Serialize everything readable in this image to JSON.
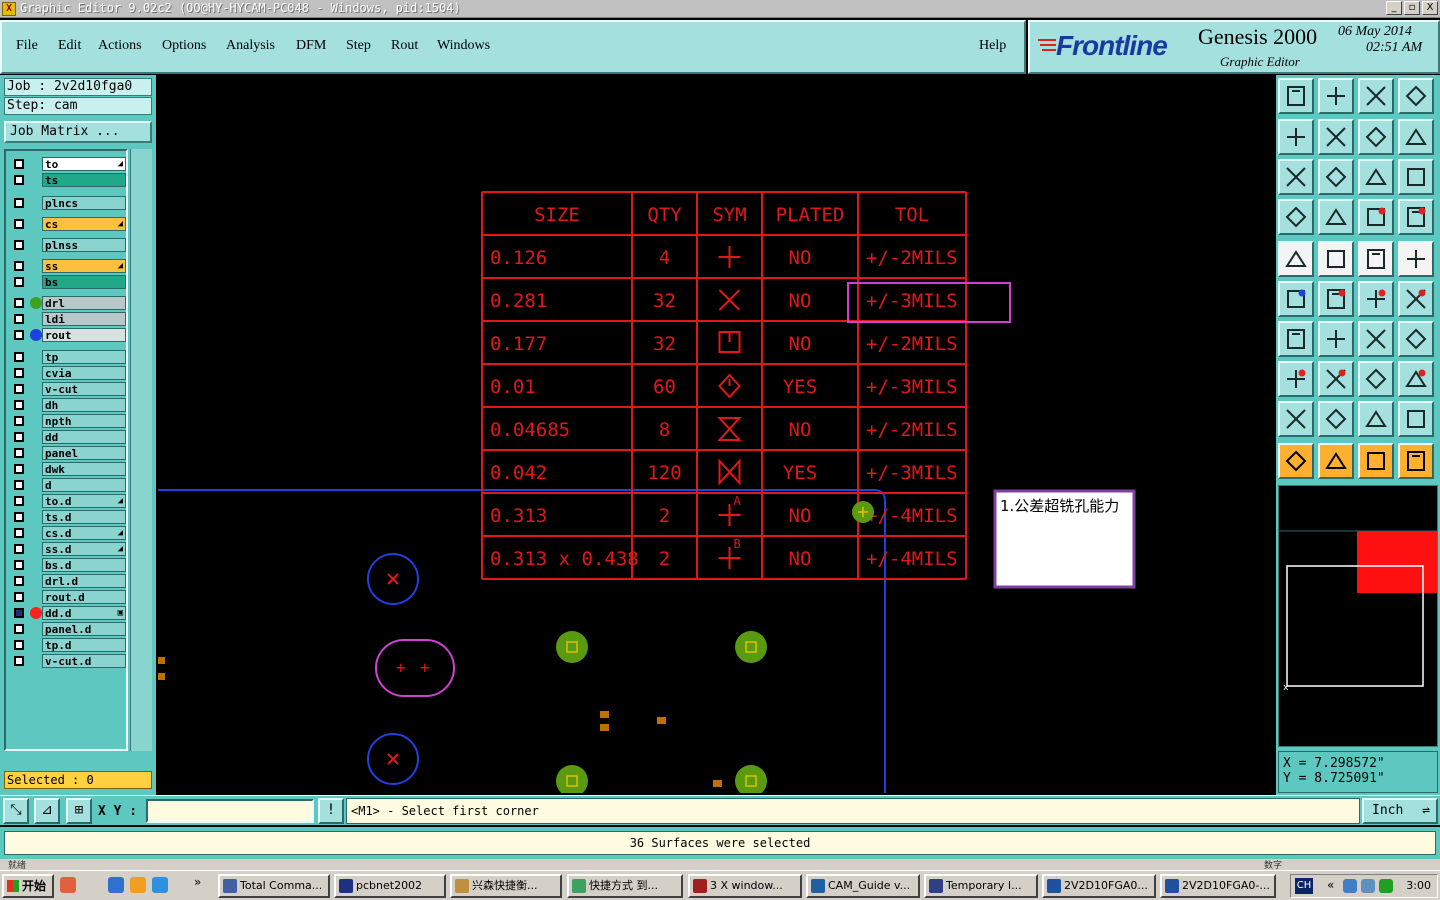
{
  "window": {
    "title": "Graphic Editor 9.02c2 (OO@HY-HYCAM-PC048 - Windows, pid:1504)",
    "minimize": "_",
    "restore": "▫",
    "close": "X"
  },
  "menu": {
    "items": [
      "File",
      "Edit",
      "Actions",
      "Options",
      "Analysis",
      "DFM",
      "Step",
      "Rout",
      "Windows"
    ],
    "help": "Help"
  },
  "brand": {
    "logo": "Frontline",
    "product": "Genesis 2000",
    "subtitle": "Graphic Editor",
    "date": "06 May 2014",
    "time": "02:51 AM"
  },
  "job": {
    "job_label": "Job : 2v2d10fga0",
    "step_label": "Step: cam",
    "matrix_button": "Job Matrix ..."
  },
  "layers": [
    {
      "name": "to",
      "color": "#ffffff",
      "mark": "◢",
      "dot": ""
    },
    {
      "name": "ts",
      "color": "#20a888",
      "mark": "",
      "dot": ""
    },
    {
      "name": "plncs",
      "color": "#8ad4d0",
      "mark": "",
      "dot": ""
    },
    {
      "name": "cs",
      "color": "#ffc040",
      "mark": "◢",
      "dot": ""
    },
    {
      "name": "plnss",
      "color": "#8ad4d0",
      "mark": "",
      "dot": ""
    },
    {
      "name": "ss",
      "color": "#ffc040",
      "mark": "◢",
      "dot": ""
    },
    {
      "name": "bs",
      "color": "#20a888",
      "mark": "",
      "dot": ""
    },
    {
      "name": "drl",
      "color": "#b8c8c8",
      "mark": "",
      "dot": "#40a020"
    },
    {
      "name": "ldi",
      "color": "#b8c8c8",
      "mark": "",
      "dot": ""
    },
    {
      "name": "rout",
      "color": "#d8e0e0",
      "mark": "",
      "dot": "#2040e0"
    },
    {
      "name": "tp",
      "color": "#8ad4d0",
      "mark": "",
      "dot": ""
    },
    {
      "name": "cvia",
      "color": "#8ad4d0",
      "mark": "",
      "dot": ""
    },
    {
      "name": "v-cut",
      "color": "#8ad4d0",
      "mark": "",
      "dot": ""
    },
    {
      "name": "dh",
      "color": "#8ad4d0",
      "mark": "",
      "dot": ""
    },
    {
      "name": "npth",
      "color": "#8ad4d0",
      "mark": "",
      "dot": ""
    },
    {
      "name": "dd",
      "color": "#8ad4d0",
      "mark": "",
      "dot": ""
    },
    {
      "name": "panel",
      "color": "#8ad4d0",
      "mark": "",
      "dot": ""
    },
    {
      "name": "dwk",
      "color": "#8ad4d0",
      "mark": "",
      "dot": ""
    },
    {
      "name": "d",
      "color": "#8ad4d0",
      "mark": "",
      "dot": ""
    },
    {
      "name": "to.d",
      "color": "#8ad4d0",
      "mark": "◢",
      "dot": ""
    },
    {
      "name": "ts.d",
      "color": "#8ad4d0",
      "mark": "",
      "dot": ""
    },
    {
      "name": "cs.d",
      "color": "#8ad4d0",
      "mark": "◢",
      "dot": ""
    },
    {
      "name": "ss.d",
      "color": "#8ad4d0",
      "mark": "◢",
      "dot": ""
    },
    {
      "name": "bs.d",
      "color": "#8ad4d0",
      "mark": "",
      "dot": ""
    },
    {
      "name": "drl.d",
      "color": "#8ad4d0",
      "mark": "",
      "dot": ""
    },
    {
      "name": "rout.d",
      "color": "#8ad4d0",
      "mark": "",
      "dot": ""
    },
    {
      "name": "dd.d",
      "color": "#8ad4d0",
      "mark": "▣",
      "dot": "#ff2020"
    },
    {
      "name": "panel.d",
      "color": "#8ad4d0",
      "mark": "",
      "dot": ""
    },
    {
      "name": "tp.d",
      "color": "#8ad4d0",
      "mark": "",
      "dot": ""
    },
    {
      "name": "v-cut.d",
      "color": "#8ad4d0",
      "mark": "",
      "dot": ""
    }
  ],
  "selected_count": "Selected : 0",
  "drill_table": {
    "headers": [
      "SIZE",
      "QTY",
      "SYM",
      "PLATED",
      "TOL"
    ],
    "rows": [
      [
        "0.126",
        "4",
        "plus",
        "NO",
        "+/-2MILS"
      ],
      [
        "0.281",
        "32",
        "x",
        "NO",
        "+/-3MILS"
      ],
      [
        "0.177",
        "32",
        "box-line",
        "NO",
        "+/-2MILS"
      ],
      [
        "0.01",
        "60",
        "diamond",
        "YES",
        "+/-3MILS"
      ],
      [
        "0.04685",
        "8",
        "hourglass",
        "NO",
        "+/-2MILS"
      ],
      [
        "0.042",
        "120",
        "bowtie",
        "YES",
        "+/-3MILS"
      ],
      [
        "0.313",
        "2",
        "plus-A",
        "NO",
        "+/-4MILS"
      ],
      [
        "0.313 x 0.438",
        "2",
        "plus-B",
        "NO",
        "+/-4MILS"
      ]
    ],
    "sym_letters": {
      "plus-A": "A",
      "plus-B": "B"
    }
  },
  "note_box": "1.公差超铣孔能力",
  "coords": {
    "x": "X = 7.298572\"",
    "y": "Y = 8.725091\""
  },
  "command": {
    "xy_label": "X Y :",
    "xy_value": "",
    "prompt": "<M1> - Select first corner",
    "units": "Inch",
    "info_button": "!"
  },
  "status_message": "36 Surfaces were selected",
  "tiny_left": "就绪",
  "tiny_right": "数字",
  "taskbar": {
    "start": "开始",
    "tasks": [
      "Total Comma...",
      "pcbnet2002",
      "兴森快捷衡...",
      "快捷方式 到...",
      "3 X window...",
      "CAM_Guide v...",
      "Temporary I...",
      "2V2D10FGA0...",
      "2V2D10FGA0-..."
    ],
    "lang": "CH",
    "clock": "3:00",
    "chevron": "»",
    "tray_chevron": "«"
  },
  "colors": {
    "panel": "#5dc8c0",
    "menu": "#a3e0de",
    "table_red": "#e01818",
    "rout_blue": "#2040e0",
    "highlight_magenta": "#d040d0",
    "drill_green": "#5a9a10"
  }
}
